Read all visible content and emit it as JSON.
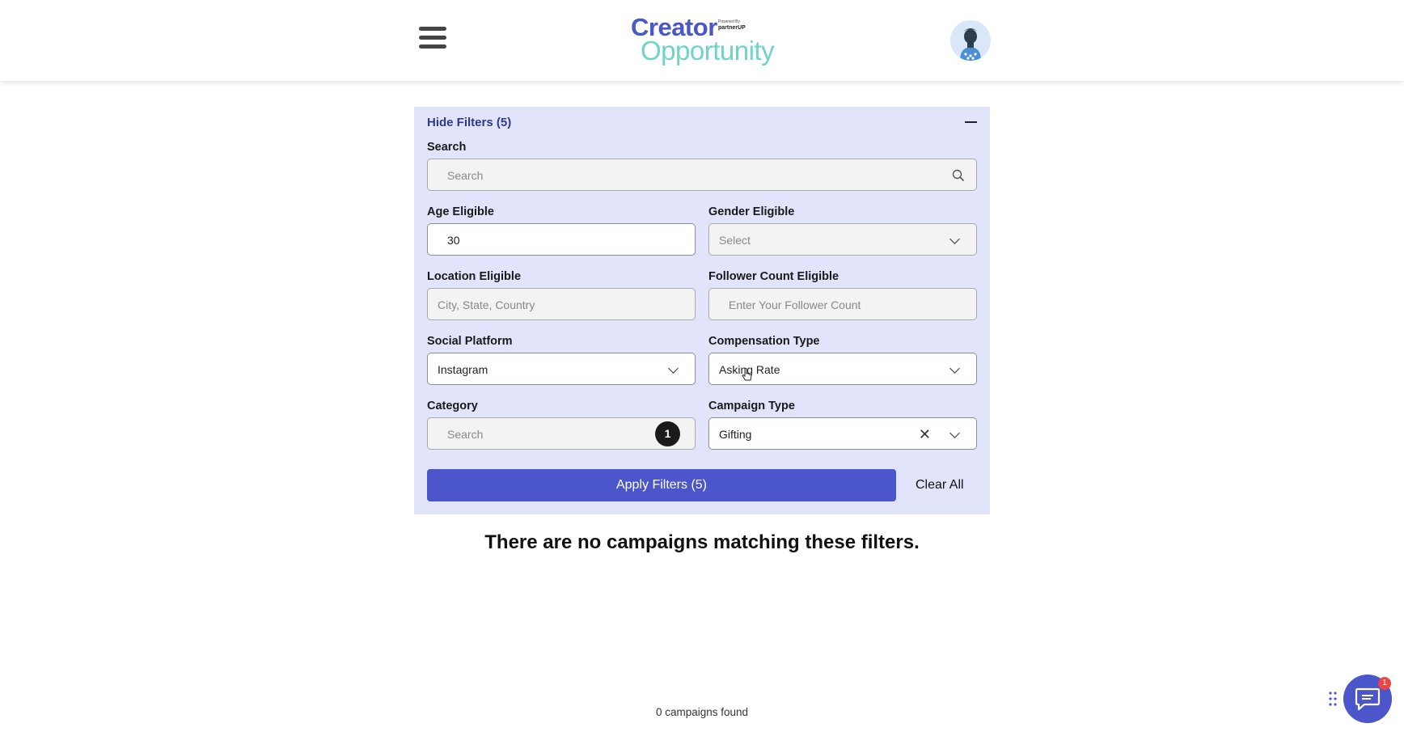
{
  "header": {
    "logo_line1": "Creator",
    "logo_line2": "Opportunity",
    "logo_powered_by": "Powered By",
    "logo_partner": "partnerUP"
  },
  "filters": {
    "toggle_label": "Hide Filters (5)",
    "search": {
      "label": "Search",
      "placeholder": "Search"
    },
    "age": {
      "label": "Age Eligible",
      "value": "30"
    },
    "gender": {
      "label": "Gender Eligible",
      "value": "Select"
    },
    "location": {
      "label": "Location Eligible",
      "placeholder": "City, State, Country"
    },
    "follower": {
      "label": "Follower Count Eligible",
      "placeholder": "Enter Your Follower Count"
    },
    "platform": {
      "label": "Social Platform",
      "value": "Instagram"
    },
    "compensation": {
      "label": "Compensation Type",
      "value": "Asking Rate"
    },
    "category": {
      "label": "Category",
      "placeholder": "Search",
      "selected_count": "1"
    },
    "campaign_type": {
      "label": "Campaign Type",
      "value": "Gifting"
    },
    "apply_label": "Apply Filters (5)",
    "clear_label": "Clear All"
  },
  "results": {
    "empty_message": "There are no campaigns matching these filters.",
    "count_text": "0 campaigns found"
  },
  "chat": {
    "badge": "1"
  },
  "colors": {
    "accent": "#4a56c9",
    "panel": "#e2e4fc",
    "logo_teal": "#6ed4c7"
  }
}
